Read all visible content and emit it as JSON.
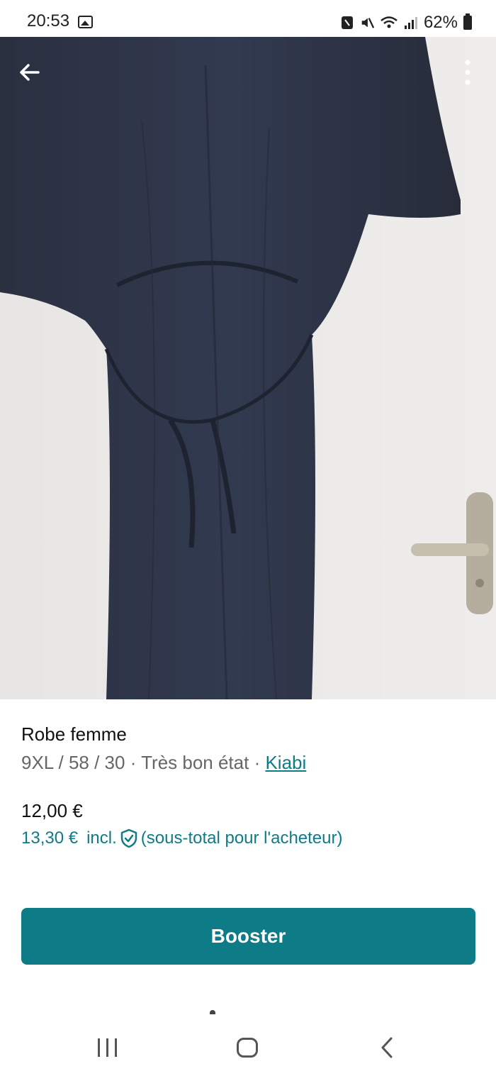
{
  "status_bar": {
    "time": "20:53",
    "battery": "62%",
    "icons": [
      "gallery-icon",
      "nfc-icon",
      "mute-icon",
      "wifi-icon",
      "signal-icon",
      "battery-icon"
    ]
  },
  "photo": {
    "description_icon": "photo",
    "page_indicator": {
      "count": 3,
      "active": 0
    }
  },
  "toolbar": {
    "back_icon": "arrow-left-icon",
    "more_icon": "more-vertical-icon"
  },
  "item": {
    "title": "Robe femme",
    "meta_prefix": "9XL / 58 / 30 · Très bon état · ",
    "brand": "Kiabi",
    "price": "12,00 €",
    "price_incl_amount": "13,30 €",
    "price_incl_label": "incl.",
    "price_incl_note": "(sous-total pour l'acheteur)"
  },
  "actions": {
    "booster_label": "Booster"
  },
  "colors": {
    "accent": "#0e7c86",
    "dress": "#2b3142",
    "wall": "#e9e7e5"
  }
}
